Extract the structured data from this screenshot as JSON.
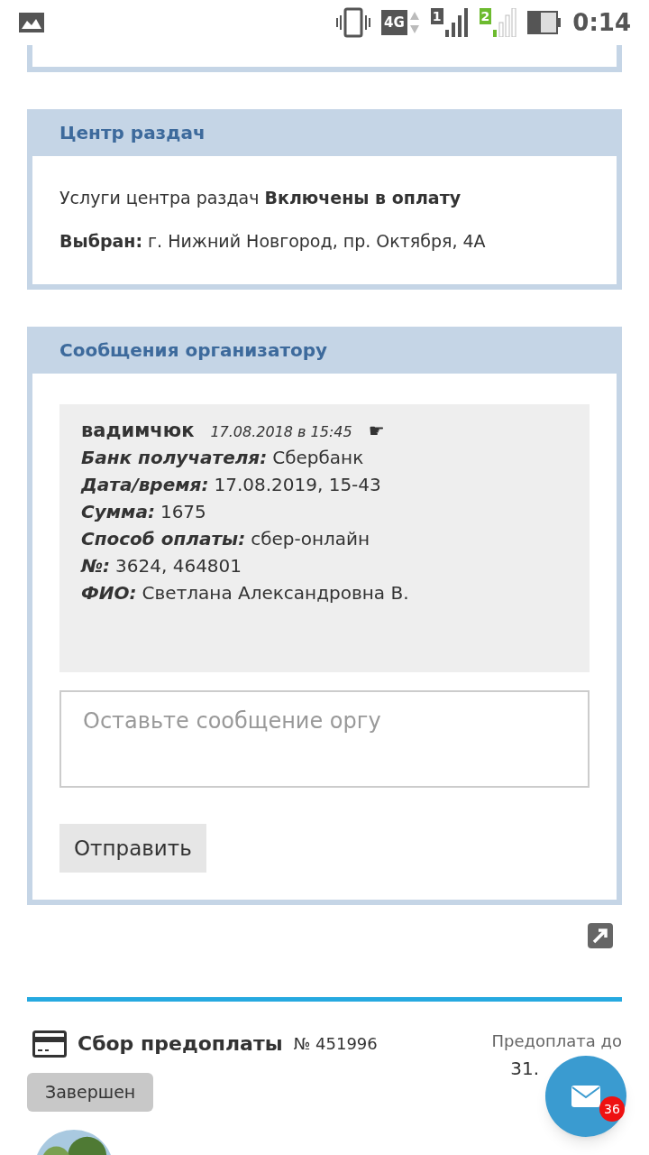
{
  "status_bar": {
    "network": "4G",
    "sims": [
      {
        "label": "1"
      },
      {
        "label": "2"
      }
    ],
    "time": "0:14"
  },
  "distribution_center": {
    "title": "Центр раздач",
    "lines": [
      "Услуги центра раздач **Включены в оплату**",
      "**Выбран:** г. Нижний Новгород, пр. Октября, 4А"
    ]
  },
  "messages": {
    "title": "Сообщения организатору",
    "message": {
      "author": "вадимчюк",
      "date": "17.08.2018 в 15:45",
      "reply_icon": "☛",
      "fields": [
        {
          "label": "Банк получателя:",
          "value": "Сбербанк"
        },
        {
          "label": "Дата/время:",
          "value": "17.08.2019, 15-43"
        },
        {
          "label": "Сумма:",
          "value": "1675"
        },
        {
          "label": "Способ оплаты:",
          "value": "сбер-онлайн"
        },
        {
          "label": "№:",
          "value": "3624, 464801"
        },
        {
          "label": "ФИО:",
          "value": "Светлана Александровна В."
        }
      ]
    },
    "input": {
      "placeholder": "Оставьте сообщение оргу"
    },
    "send_button": "Отправить"
  },
  "purchase": {
    "title": "Сбор предоплаты",
    "number": "№ 451996",
    "deadline_label": "Предоплата до",
    "deadline_value": "31.",
    "status": "Завершен"
  },
  "fab": {
    "badge": "36"
  }
}
